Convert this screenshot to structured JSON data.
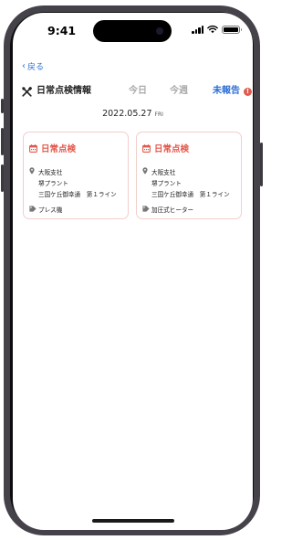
{
  "status_bar": {
    "time": "9:41"
  },
  "nav": {
    "back_label": "戻る"
  },
  "tabs": [
    {
      "label": "日常点検情報",
      "active": true
    },
    {
      "label": "今日",
      "active": false
    },
    {
      "label": "今週",
      "active": false
    },
    {
      "label": "未報告",
      "active": false,
      "badge": "!"
    }
  ],
  "date": {
    "value": "2022.05.27",
    "weekday": "FRI"
  },
  "cards": [
    {
      "title": "日常点検",
      "location": {
        "branch": "大阪支社",
        "plant": "堺プラント",
        "line": "三国ケ丘御幸通　第１ライン"
      },
      "tag": "プレス機"
    },
    {
      "title": "日常点検",
      "location": {
        "branch": "大阪支社",
        "plant": "堺プラント",
        "line": "三国ケ丘御幸通　第１ライン"
      },
      "tag": "加圧式ヒーター"
    }
  ],
  "colors": {
    "accent_red": "#e2584c",
    "link_blue": "#2e6fd6",
    "card_border": "#f0cfcb"
  }
}
